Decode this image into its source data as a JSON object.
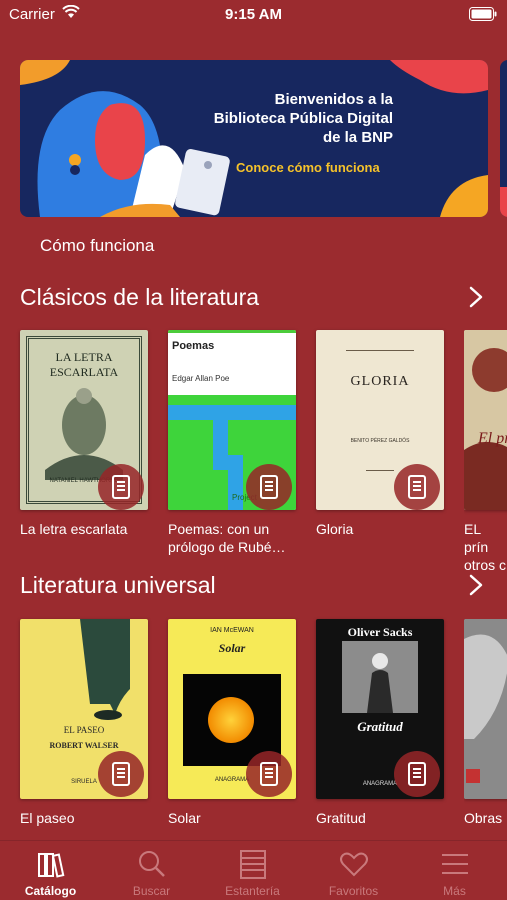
{
  "status_bar": {
    "carrier": "Carrier",
    "time": "9:15 AM"
  },
  "banner": {
    "line1": "Bienvenidos a la",
    "line2": "Biblioteca Pública Digital",
    "line3": "de la BNP",
    "cta": "Conoce cómo funciona"
  },
  "how_link": "Cómo funciona",
  "sections": [
    {
      "title": "Clásicos de la literatura",
      "books": [
        {
          "title": "La letra escarlata",
          "cover_title": "LA LETRA ESCARLATA",
          "cover_author": "NATANIEL HAWTHORNE"
        },
        {
          "title": "Poemas: con un prólogo de Rubé…",
          "cover_title": "Poemas",
          "cover_author": "Edgar Allan Poe",
          "cover_footer": "Project"
        },
        {
          "title": "Gloria",
          "cover_title": "GLORIA",
          "cover_author": "BENITO PÉREZ GALDÓS"
        },
        {
          "title": "EL prín otros c",
          "cover_title": "El prí feli"
        }
      ]
    },
    {
      "title": "Literatura universal",
      "books": [
        {
          "title": "El paseo",
          "cover_title": "EL PASEO",
          "cover_author": "ROBERT WALSER",
          "cover_footer": "SIRUELA"
        },
        {
          "title": "Solar",
          "cover_title": "Solar",
          "cover_author": "IAN McEWAN",
          "cover_footer": "ANAGRAMA"
        },
        {
          "title": "Gratitud",
          "cover_title": "Gratitud",
          "cover_author": "Oliver Sacks",
          "cover_footer": "ANAGRAMA"
        },
        {
          "title": "Obras"
        }
      ]
    }
  ],
  "tabs": [
    {
      "label": "Catálogo",
      "icon": "books-icon",
      "active": true
    },
    {
      "label": "Buscar",
      "icon": "search-icon"
    },
    {
      "label": "Estantería",
      "icon": "shelf-icon"
    },
    {
      "label": "Favoritos",
      "icon": "heart-icon"
    },
    {
      "label": "Más",
      "icon": "menu-icon"
    }
  ],
  "colors": {
    "background": "#9b2b2f",
    "banner": "#17275f",
    "banner_cta": "#f5c22a",
    "tab_inactive": "#c9797c"
  }
}
